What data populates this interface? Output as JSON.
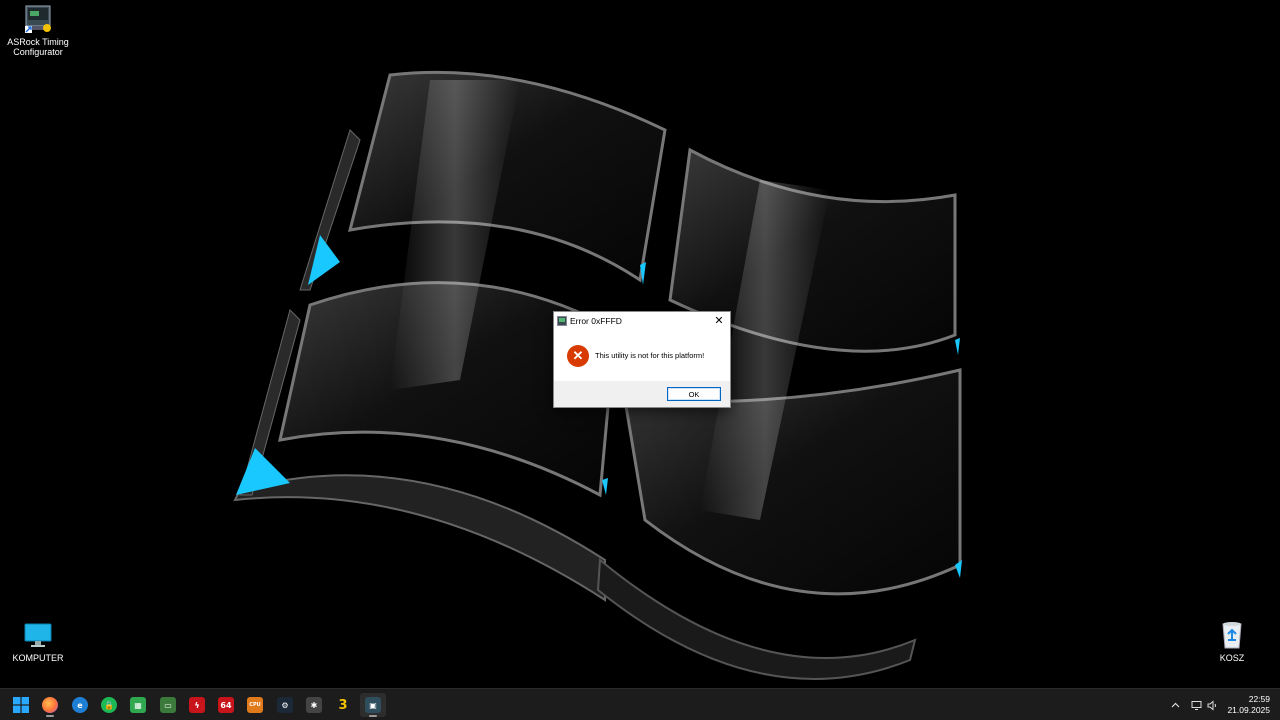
{
  "desktop": {
    "icons": [
      {
        "label_line1": "ASRock Timing",
        "label_line2": "Configurator"
      },
      {
        "label_line1": "KOMPUTER",
        "label_line2": ""
      },
      {
        "label_line1": "KOSZ",
        "label_line2": ""
      }
    ]
  },
  "dialog": {
    "title": "Error 0xFFFD",
    "message": "This utility is not for this platform!",
    "ok_label": "OK",
    "close_glyph": "✕",
    "error_glyph": "✕"
  },
  "taskbar": {
    "apps": [
      {
        "name": "start",
        "icon": "windows-start-icon",
        "color": "#0a84ff"
      },
      {
        "name": "firefox",
        "icon": "firefox-icon",
        "color": "#ff7139"
      },
      {
        "name": "app-e",
        "icon": "browser-e-icon",
        "color": "#1e7fd6",
        "glyph": "e"
      },
      {
        "name": "app-green-lock",
        "icon": "green-lock-icon",
        "color": "#1db954",
        "glyph": "🔒"
      },
      {
        "name": "app-green",
        "icon": "green-grid-icon",
        "color": "#2fa84f",
        "glyph": "▦"
      },
      {
        "name": "app-gpu",
        "icon": "gpu-icon",
        "color": "#3b7a3a",
        "glyph": "▭"
      },
      {
        "name": "app-flash",
        "icon": "red-flash-icon",
        "color": "#c8151b",
        "glyph": "ϟ"
      },
      {
        "name": "aida64",
        "icon": "aida64-icon",
        "color": "#c8151b",
        "glyph": "64"
      },
      {
        "name": "cpu-z",
        "icon": "cpu-icon",
        "color": "#e07a1b",
        "glyph": "CPU"
      },
      {
        "name": "steam",
        "icon": "steam-icon",
        "color": "#1b2838",
        "glyph": "⚙"
      },
      {
        "name": "app-spider",
        "icon": "spider-icon",
        "color": "#444",
        "glyph": "✱"
      },
      {
        "name": "app-3",
        "icon": "yellow-3-icon",
        "color": "#1c1c1c",
        "glyph": "3"
      },
      {
        "name": "asrock-timing",
        "icon": "asrock-timing-icon",
        "color": "#2e4e5e",
        "glyph": "▣"
      }
    ],
    "tray": {
      "chevron": "^",
      "network": "▭",
      "volume": "🔈"
    },
    "time": "22:59",
    "date": "21.09.2025"
  }
}
